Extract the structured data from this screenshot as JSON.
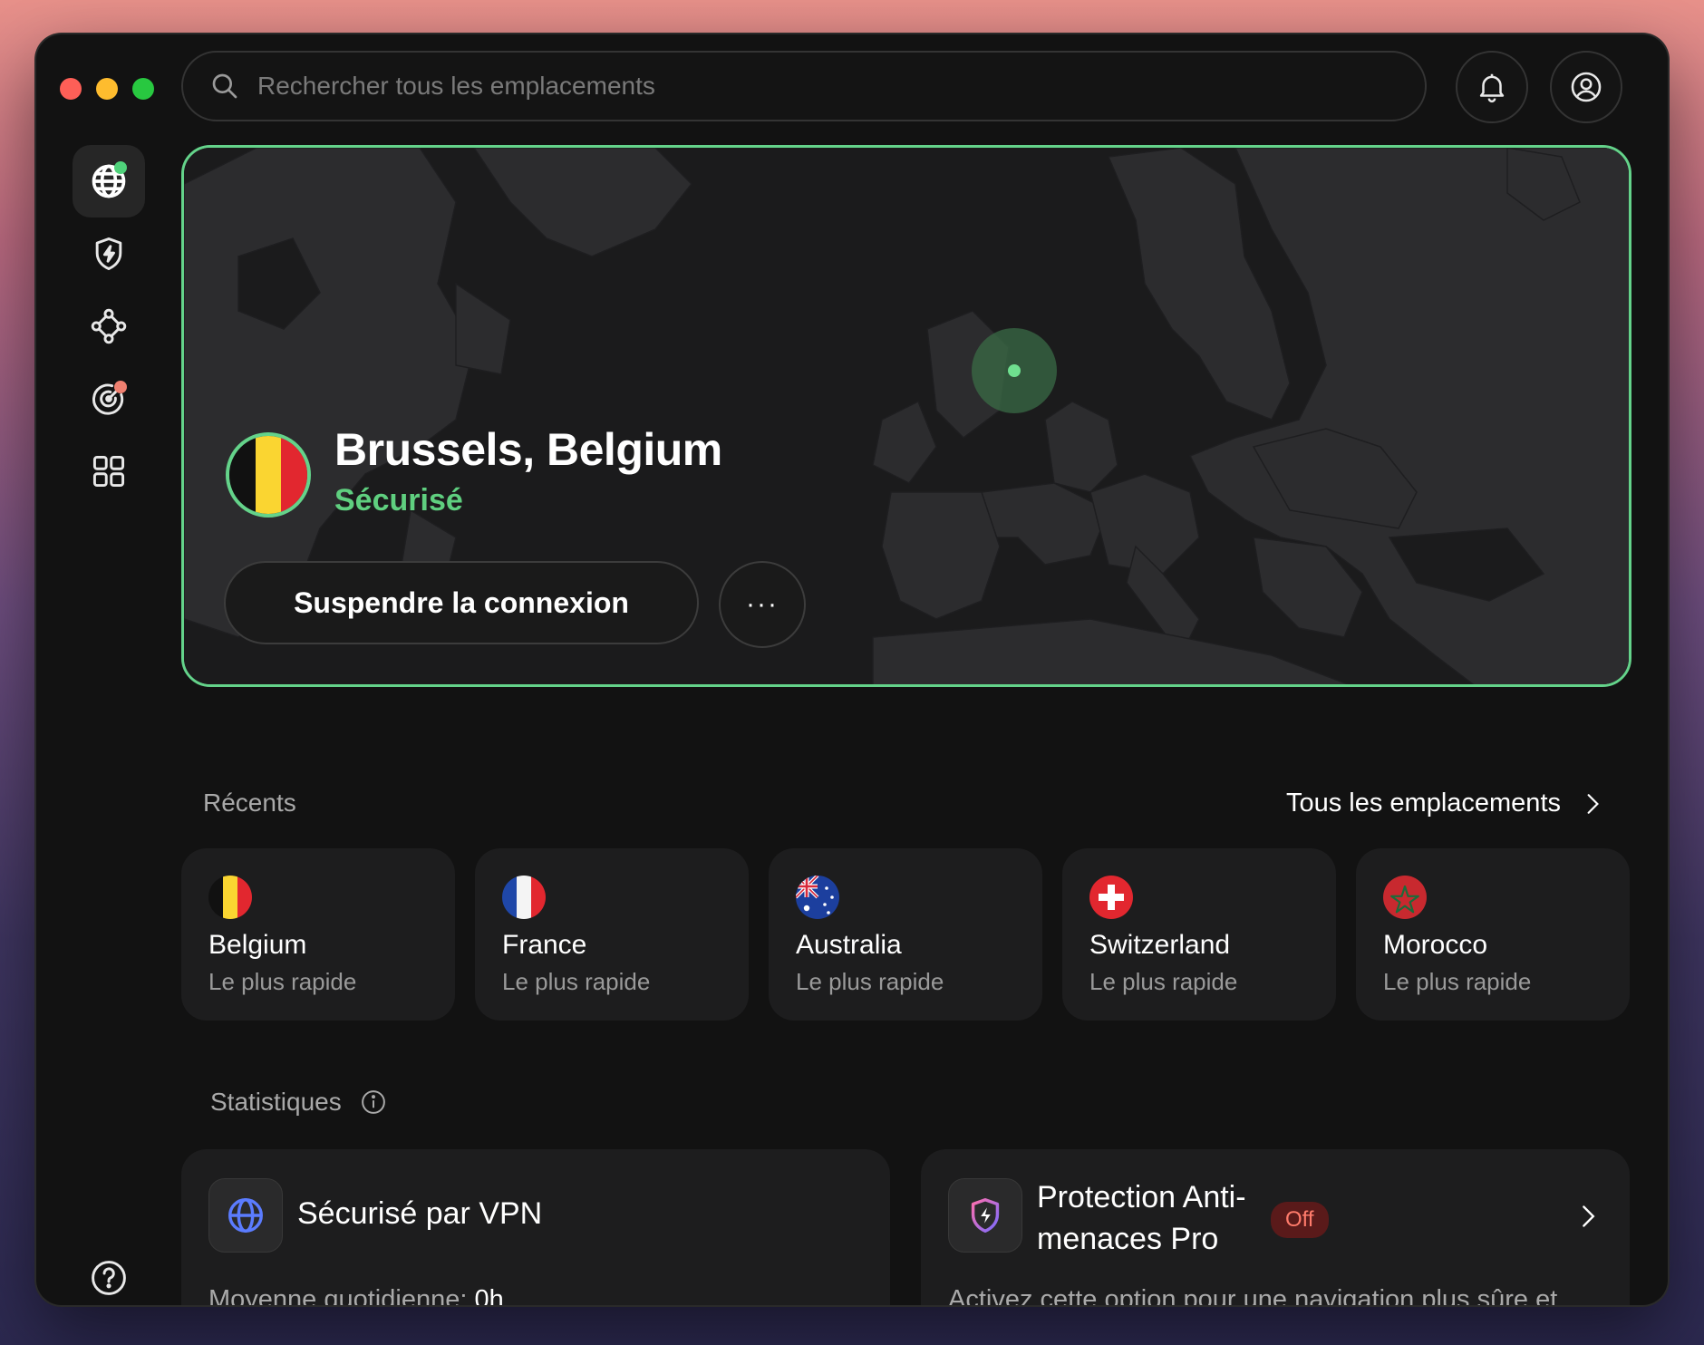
{
  "search": {
    "placeholder": "Rechercher tous les emplacements"
  },
  "connection": {
    "location": "Brussels, Belgium",
    "status": "Sécurisé",
    "pause_label": "Suspendre la connexion",
    "more_label": "···"
  },
  "recents": {
    "heading": "Récents",
    "all_link": "Tous les emplacements",
    "items": [
      {
        "name": "Belgium",
        "sub": "Le plus rapide",
        "flag": "belgium-flag"
      },
      {
        "name": "France",
        "sub": "Le plus rapide",
        "flag": "france-flag"
      },
      {
        "name": "Australia",
        "sub": "Le plus rapide",
        "flag": "australia-flag"
      },
      {
        "name": "Switzerland",
        "sub": "Le plus rapide",
        "flag": "switzerland-flag"
      },
      {
        "name": "Morocco",
        "sub": "Le plus rapide",
        "flag": "morocco-flag"
      }
    ]
  },
  "stats": {
    "heading": "Statistiques",
    "vpn": {
      "title": "Sécurisé par VPN",
      "sub_label": "Moyenne quotidienne:",
      "sub_value": "0h"
    },
    "threat": {
      "title": "Protection Anti-menaces Pro",
      "badge": "Off",
      "sub": "Activez cette option pour une navigation plus sûre et"
    }
  },
  "colors": {
    "accent_green": "#64d38a",
    "status_green": "#5fcf7f",
    "off_red": "#ff7b6b",
    "window_bg": "#121212"
  }
}
